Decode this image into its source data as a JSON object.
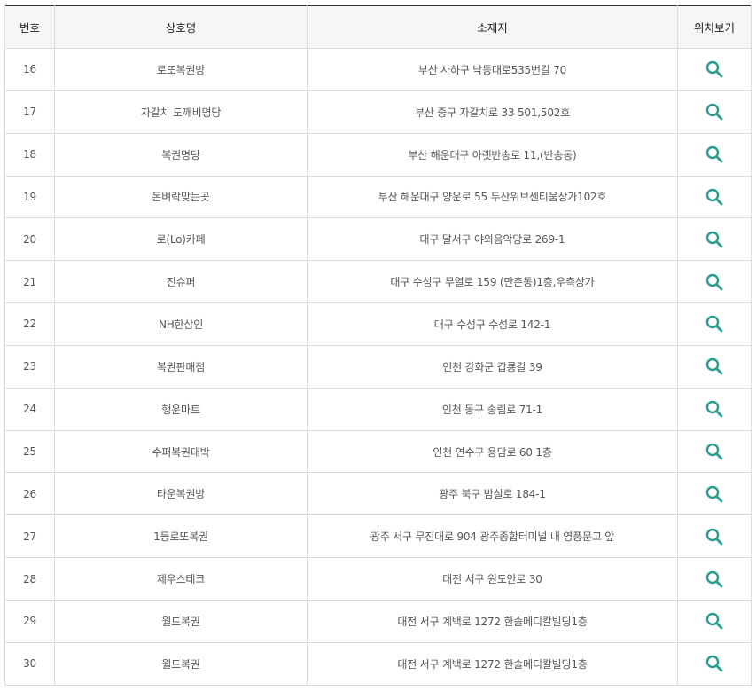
{
  "table": {
    "headers": {
      "num": "번호",
      "name": "상호명",
      "address": "소재지",
      "location": "위치보기"
    },
    "rows": [
      {
        "num": "16",
        "name": "로또복권방",
        "address": "부산 사하구 낙동대로535번길 70"
      },
      {
        "num": "17",
        "name": "자갈치 도깨비명당",
        "address": "부산 중구 자갈치로 33 501,502호"
      },
      {
        "num": "18",
        "name": "복권명당",
        "address": "부산 해운대구 아랫반송로 11,(반송동)"
      },
      {
        "num": "19",
        "name": "돈벼락맞는곳",
        "address": "부산 해운대구 양운로 55 두산위브센티움상가102호"
      },
      {
        "num": "20",
        "name": "로(Lo)카페",
        "address": "대구 달서구 야외음악당로 269-1"
      },
      {
        "num": "21",
        "name": "진슈퍼",
        "address": "대구 수성구 무열로 159 (만촌동)1층,우측상가"
      },
      {
        "num": "22",
        "name": "NH한삼인",
        "address": "대구 수성구 수성로 142-1"
      },
      {
        "num": "23",
        "name": "복권판매점",
        "address": "인천 강화군 갑룡길 39"
      },
      {
        "num": "24",
        "name": "행운마트",
        "address": "인천 동구 송림로 71-1"
      },
      {
        "num": "25",
        "name": "수퍼복권대박",
        "address": "인천 연수구 용담로 60 1층"
      },
      {
        "num": "26",
        "name": "타운복권방",
        "address": "광주 북구 밤실로 184-1"
      },
      {
        "num": "27",
        "name": "1등로또복권",
        "address": "광주 서구 무진대로 904 광주종합터미널 내 영풍문고 앞"
      },
      {
        "num": "28",
        "name": "제우스테크",
        "address": "대전 서구 원도안로 30"
      },
      {
        "num": "29",
        "name": "월드복권",
        "address": "대전 서구 계백로 1272 한솔메디칼빌딩1층"
      },
      {
        "num": "30",
        "name": "월드복권",
        "address": "대전 서구 계백로 1272 한솔메디칼빌딩1층"
      }
    ]
  },
  "icons": {
    "location_button": "search-icon"
  },
  "colors": {
    "header_bg": "#f6f6f6",
    "header_top_border": "#333333",
    "grid_line": "#dcdcdc",
    "icon": "#2a9d8f",
    "cell_text": "#555555",
    "header_text": "#222222"
  }
}
